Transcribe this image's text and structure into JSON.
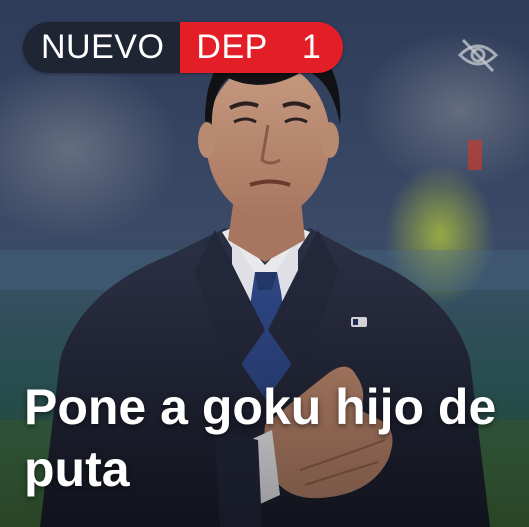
{
  "badge": {
    "new_label": "NUEVO",
    "category_label": "DEP",
    "count": "1"
  },
  "headline": "Pone a goku hijo de puta",
  "icons": {
    "hide": "eye-off-icon",
    "lapel_pin": "lapel-pin-icon"
  },
  "colors": {
    "badge_dark": "#1f2533",
    "badge_accent": "#e41e26",
    "headline_text": "#ffffff"
  }
}
